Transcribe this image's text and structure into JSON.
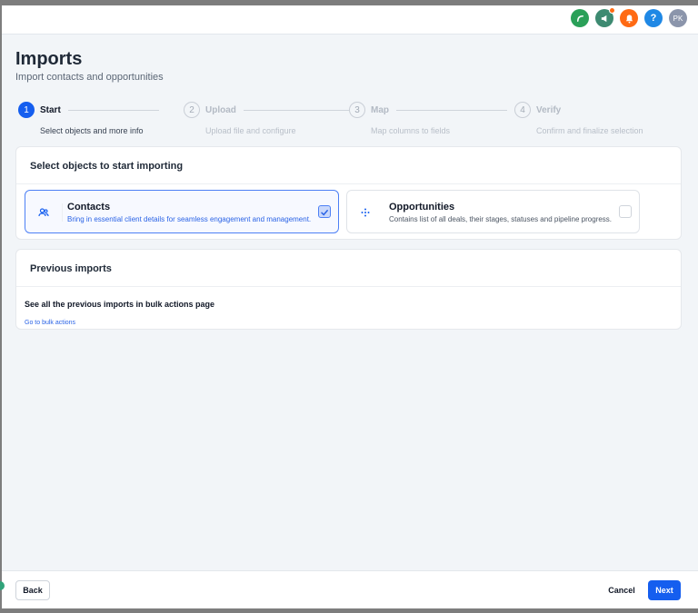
{
  "header": {
    "icons": [
      {
        "name": "phone-icon",
        "color": "#2aa058"
      },
      {
        "name": "megaphone-icon",
        "color": "#3d8a71"
      },
      {
        "name": "bell-icon",
        "color": "#ff6a13"
      },
      {
        "name": "help-icon",
        "color": "#1f88e5",
        "glyph": "?"
      },
      {
        "name": "avatar",
        "color": "#8b95ab",
        "initials": "PK"
      }
    ]
  },
  "page": {
    "title": "Imports",
    "subtitle": "Import contacts and opportunities"
  },
  "steps": [
    {
      "number": "1",
      "label": "Start",
      "description": "Select objects and more info",
      "active": true
    },
    {
      "number": "2",
      "label": "Upload",
      "description": "Upload file and configure",
      "active": false
    },
    {
      "number": "3",
      "label": "Map",
      "description": "Map columns to fields",
      "active": false
    },
    {
      "number": "4",
      "label": "Verify",
      "description": "Confirm and finalize selection",
      "active": false
    }
  ],
  "select_objects": {
    "heading": "Select objects to start importing",
    "options": [
      {
        "title": "Contacts",
        "description": "Bring in essential client details for seamless engagement and management.",
        "checked": true,
        "icon": "contacts-icon"
      },
      {
        "title": "Opportunities",
        "description": "Contains list of all deals, their stages, statuses and pipeline progress.",
        "checked": false,
        "icon": "opportunities-icon"
      }
    ]
  },
  "previous_imports": {
    "heading": "Previous imports",
    "text": "See all the previous imports in bulk actions page",
    "link": "Go to bulk actions"
  },
  "footer": {
    "back_label": "Back",
    "cancel_label": "Cancel",
    "next_label": "Next"
  },
  "colors": {
    "accent": "#155eef",
    "link": "#2a63e6"
  }
}
